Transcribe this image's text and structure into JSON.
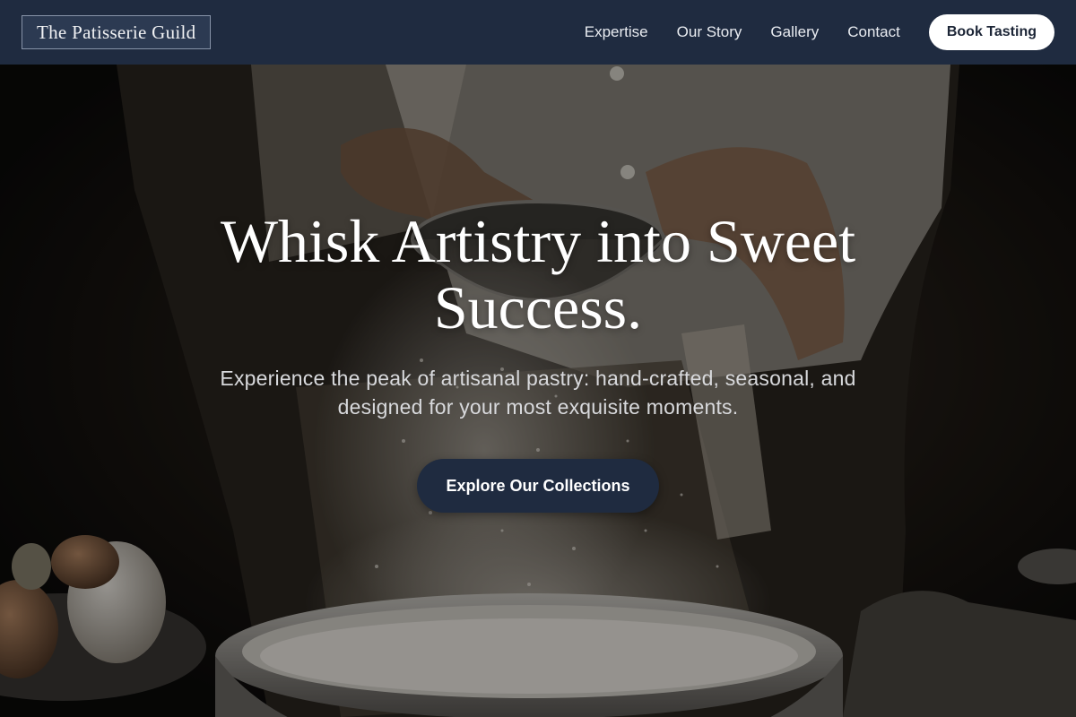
{
  "nav": {
    "brand": "The Patisserie Guild",
    "links": [
      "Expertise",
      "Our Story",
      "Gallery",
      "Contact"
    ],
    "cta": "Book Tasting"
  },
  "hero": {
    "title": "Whisk Artistry into Sweet Success.",
    "subtitle": "Experience the peak of artisanal pastry: hand-crafted, seasonal, and designed for your most exquisite moments.",
    "cta": "Explore Our Collections",
    "background_image": "baker-sifting-flour-photo"
  },
  "colors": {
    "nav_bg": "#1f2b40",
    "cta_bg": "#1f2b40",
    "nav_cta_bg": "#ffffff",
    "text_light": "#ffffff"
  }
}
